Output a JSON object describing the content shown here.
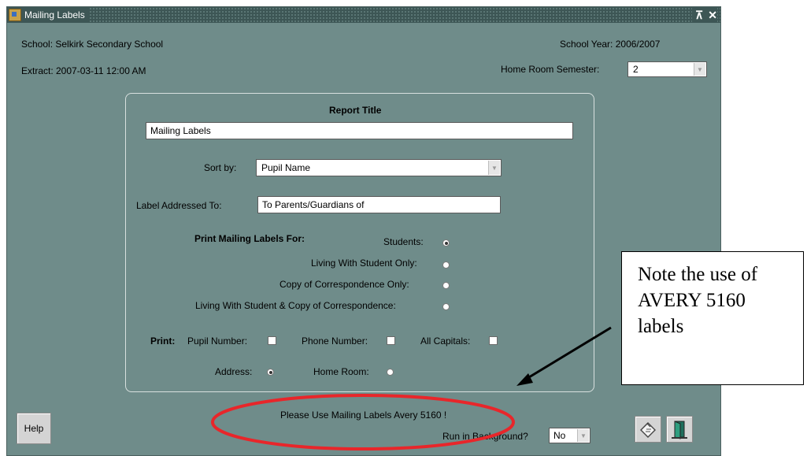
{
  "window": {
    "title": "Mailing Labels",
    "controls": [
      "⊼",
      "✕"
    ]
  },
  "header": {
    "school": "School:  Selkirk Secondary School",
    "extract": "Extract:  2007-03-11 12:00 AM",
    "school_year": "School Year:  2006/2007",
    "home_room_semester_label": "Home Room Semester:",
    "home_room_semester_value": "2"
  },
  "form": {
    "report_title_label": "Report Title",
    "report_title_value": "Mailing Labels",
    "sort_by_label": "Sort by:",
    "sort_by_value": "Pupil Name",
    "label_addressed_label": "Label Addressed To:",
    "label_addressed_value": "To Parents/Guardians of",
    "print_for_label": "Print Mailing Labels For:",
    "options": [
      {
        "label": "Students:",
        "selected": true
      },
      {
        "label": "Living With Student Only:",
        "selected": false
      },
      {
        "label": "Copy of Correspondence Only:",
        "selected": false
      },
      {
        "label": "Living With Student & Copy of Correspondence:",
        "selected": false
      }
    ],
    "print_label": "Print:",
    "pupil_number_label": "Pupil Number:",
    "phone_number_label": "Phone Number:",
    "all_capitals_label": "All Capitals:",
    "address_label": "Address:",
    "home_room_label": "Home Room:"
  },
  "footer": {
    "message": "Please Use Mailing Labels Avery 5160 !",
    "help_label": "Help",
    "background_label": "Run in Background?",
    "background_value": "No"
  },
  "callout": {
    "lines": [
      "Note the use of",
      "AVERY 5160",
      "labels"
    ]
  },
  "colors": {
    "window_bg": "#6f8c8a",
    "annotation_ellipse": "#e8262a"
  }
}
